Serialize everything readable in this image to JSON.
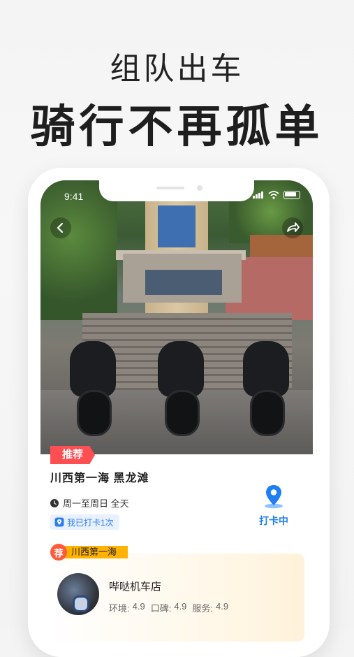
{
  "headline": {
    "line1": "组队出车",
    "line2": "骑行不再孤单"
  },
  "status_bar": {
    "time": "9:41"
  },
  "spot": {
    "tag": "推荐",
    "title": "川西第一海 黑龙滩",
    "hours": "周一至周日 全天",
    "checkin_count_text": "我已打卡1次",
    "checkin_button": "打卡中"
  },
  "section": {
    "tag_icon_text": "荐",
    "tag_label": "川西第一海"
  },
  "shop": {
    "name": "哔哒机车店",
    "ratings": [
      {
        "label": "环境:",
        "value": "4.9"
      },
      {
        "label": "口碑:",
        "value": "4.9"
      },
      {
        "label": "服务:",
        "value": "4.9"
      }
    ]
  },
  "colors": {
    "accent_blue": "#1f7ef3",
    "recommend_red": "#ff4f52",
    "tag_yellow": "#ffb300",
    "tag_orange": "#ff5a3c"
  },
  "icons": [
    "back-arrow-icon",
    "share-icon",
    "clock-icon",
    "location-pin-icon",
    "signal-icon",
    "wifi-icon",
    "battery-icon"
  ]
}
